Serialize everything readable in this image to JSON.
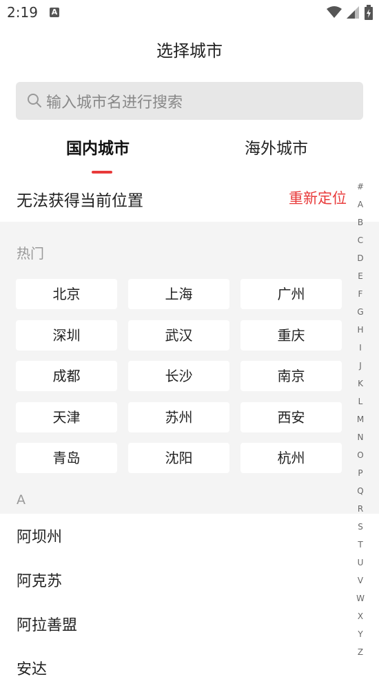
{
  "status": {
    "time": "2:19",
    "a_icon": "A"
  },
  "page_title": "选择城市",
  "search": {
    "placeholder": "输入城市名进行搜索"
  },
  "tabs": [
    {
      "label": "国内城市"
    },
    {
      "label": "海外城市"
    }
  ],
  "location": {
    "message": "无法获得当前位置",
    "relocate": "重新定位"
  },
  "hot": {
    "title": "热门",
    "cities": [
      "北京",
      "上海",
      "广州",
      "深圳",
      "武汉",
      "重庆",
      "成都",
      "长沙",
      "南京",
      "天津",
      "苏州",
      "西安",
      "青岛",
      "沈阳",
      "杭州"
    ]
  },
  "section_letter": "A",
  "list": [
    "阿坝州",
    "阿克苏",
    "阿拉善盟",
    "安达"
  ],
  "index": [
    "#",
    "A",
    "B",
    "C",
    "D",
    "E",
    "F",
    "G",
    "H",
    "I",
    "J",
    "K",
    "L",
    "M",
    "N",
    "O",
    "P",
    "Q",
    "R",
    "S",
    "T",
    "U",
    "V",
    "W",
    "X",
    "Y",
    "Z"
  ],
  "colors": {
    "accent": "#e83a3a",
    "section_bg": "#f4f4f4",
    "search_bg": "#e7e7e7"
  }
}
